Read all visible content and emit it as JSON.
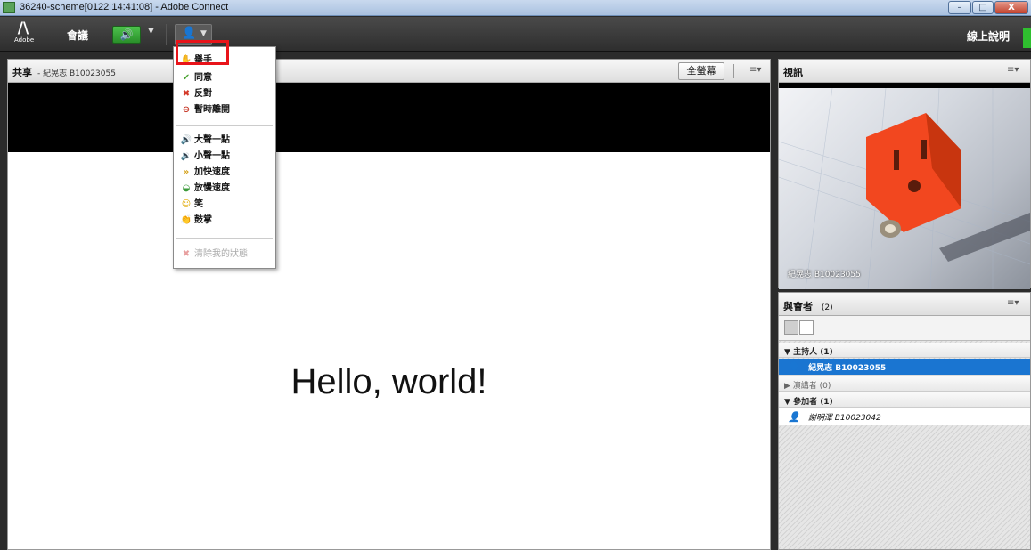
{
  "window": {
    "title": "36240-scheme[0122 14:41:08] - Adobe Connect",
    "minimize": "–",
    "maximize": "□",
    "close": "X"
  },
  "menubar": {
    "logo_word": "Adobe",
    "meeting": "會議",
    "speaker_icon": "speaker-icon",
    "help": "線上說明"
  },
  "share_pod": {
    "title": "共享",
    "subtitle": "- 紀晃志 B10023055",
    "fullscreen": "全螢幕",
    "menu": "≡▾",
    "content_text": "Hello, world!"
  },
  "video_pod": {
    "title": "視訊",
    "menu": "≡▾",
    "name": "紀晃志 B10023055"
  },
  "attendees_pod": {
    "title": "與會者",
    "count": "(2)",
    "menu": "≡▾",
    "groups": [
      {
        "label": "主持人 (1)",
        "expanded": true,
        "arrow": "▼"
      },
      {
        "label": "演講者 (0)",
        "expanded": false,
        "arrow": "▶"
      },
      {
        "label": "參加者 (1)",
        "expanded": true,
        "arrow": "▼"
      }
    ],
    "hosts": [
      {
        "name": "紀晃志 B10023055",
        "icon": "host-icon"
      }
    ],
    "participants": [
      {
        "name": "謝明澤 B10023042",
        "icon": "participant-icon"
      }
    ]
  },
  "status_menu": {
    "items": [
      {
        "label": "舉手",
        "icon": "raise-hand-icon"
      },
      {
        "label": "同意",
        "icon": "agree-icon"
      },
      {
        "label": "反對",
        "icon": "disagree-icon"
      },
      {
        "label": "暫時離開",
        "icon": "step-away-icon"
      },
      {
        "label": "大聲一點",
        "icon": "louder-icon"
      },
      {
        "label": "小聲一點",
        "icon": "softer-icon"
      },
      {
        "label": "加快速度",
        "icon": "speed-up-icon"
      },
      {
        "label": "放慢速度",
        "icon": "slow-down-icon"
      },
      {
        "label": "笑",
        "icon": "laugh-icon"
      },
      {
        "label": "鼓掌",
        "icon": "applause-icon"
      },
      {
        "label": "清除我的狀態",
        "icon": "clear-status-icon"
      }
    ]
  },
  "colors": {
    "selected_row": "#1a75d1",
    "highlight": "#e8141a",
    "speaker_green": "#2a8f2a"
  }
}
